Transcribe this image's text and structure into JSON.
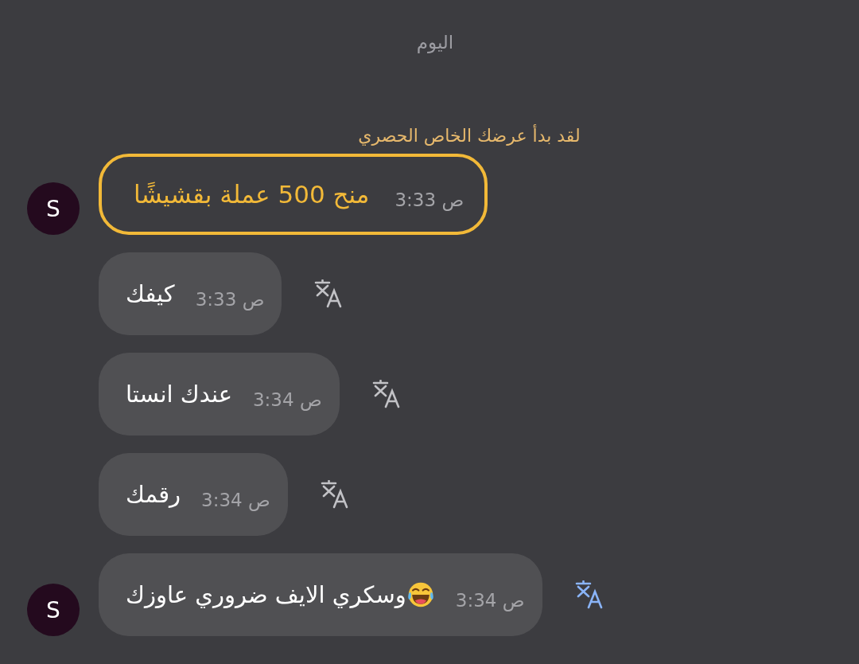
{
  "date_divider": "اليوم",
  "system_notice": "لقد بدأ عرضك الخاص الحصري",
  "messages": [
    {
      "kind": "tip",
      "text": "منح 500 عملة بقشيشًا",
      "time": "ص 3:33",
      "show_avatar": true,
      "avatar": "S"
    },
    {
      "kind": "text",
      "text": "كيفك",
      "time": "ص 3:33",
      "show_avatar": false,
      "translate_active": false
    },
    {
      "kind": "text",
      "text": "عندك انستا",
      "time": "ص 3:34",
      "show_avatar": false,
      "translate_active": false
    },
    {
      "kind": "text",
      "text": "رقمك",
      "time": "ص 3:34",
      "show_avatar": false,
      "translate_active": false
    },
    {
      "kind": "text",
      "text": "وسكري الايف ضروري عاوزك",
      "emoji": true,
      "time": "ص 3:34",
      "show_avatar": true,
      "avatar": "S",
      "translate_active": true
    }
  ]
}
